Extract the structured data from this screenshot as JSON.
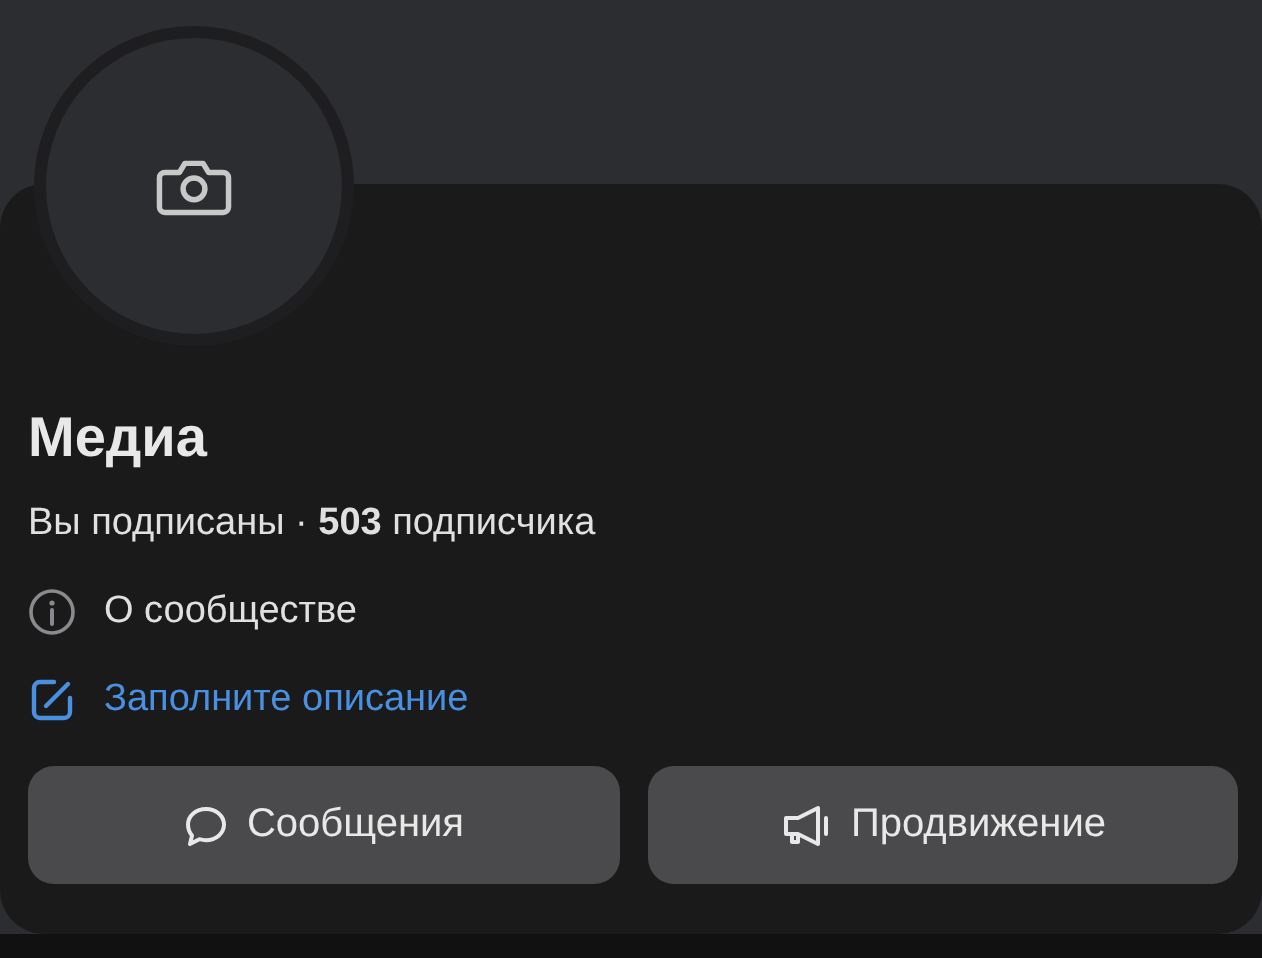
{
  "profile": {
    "name": "Медиа",
    "subtitle": "Вы подписаны · **503** подписчика"
  },
  "info_rows": [
    {
      "kind": "info",
      "text": "О сообществе"
    },
    {
      "kind": "link",
      "text": "Заполните описание"
    }
  ],
  "buttons": [
    {
      "kind": "message",
      "label": "Сообщения"
    },
    {
      "kind": "promote",
      "label": "Продвижение"
    }
  ]
}
